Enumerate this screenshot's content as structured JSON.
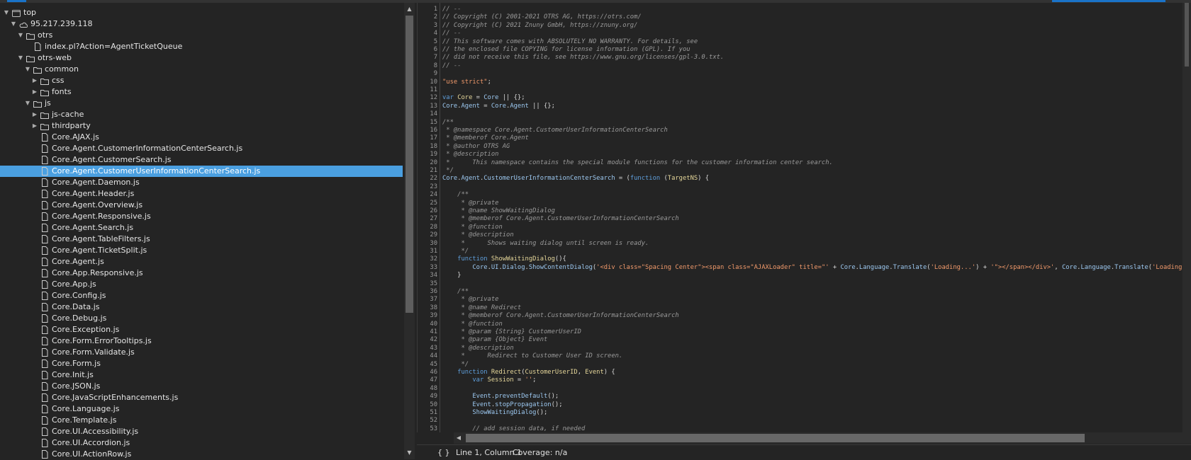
{
  "colors": {
    "accent": "#1a73c8",
    "selection": "#4a9fe0",
    "comment": "#9a9a9a",
    "string": "#f29a6b",
    "keyword": "#5f9fdc",
    "identifier": "#9cc8f0",
    "function_name": "#e6d79a"
  },
  "tree": [
    {
      "label": "top",
      "icon": "frame",
      "depth": 0,
      "expanded": true
    },
    {
      "label": "95.217.239.118",
      "icon": "cloud",
      "depth": 1,
      "expanded": true
    },
    {
      "label": "otrs",
      "icon": "folder",
      "depth": 2,
      "expanded": true
    },
    {
      "label": "index.pl?Action=AgentTicketQueue",
      "icon": "file",
      "depth": 3,
      "expanded": null
    },
    {
      "label": "otrs-web",
      "icon": "folder",
      "depth": 2,
      "expanded": true
    },
    {
      "label": "common",
      "icon": "folder",
      "depth": 3,
      "expanded": true
    },
    {
      "label": "css",
      "icon": "folder",
      "depth": 4,
      "expanded": false
    },
    {
      "label": "fonts",
      "icon": "folder",
      "depth": 4,
      "expanded": false
    },
    {
      "label": "js",
      "icon": "folder",
      "depth": 3,
      "expanded": true
    },
    {
      "label": "js-cache",
      "icon": "folder",
      "depth": 4,
      "expanded": false
    },
    {
      "label": "thirdparty",
      "icon": "folder",
      "depth": 4,
      "expanded": false
    },
    {
      "label": "Core.AJAX.js",
      "icon": "file",
      "depth": 4
    },
    {
      "label": "Core.Agent.CustomerInformationCenterSearch.js",
      "icon": "file",
      "depth": 4
    },
    {
      "label": "Core.Agent.CustomerSearch.js",
      "icon": "file",
      "depth": 4
    },
    {
      "label": "Core.Agent.CustomerUserInformationCenterSearch.js",
      "icon": "file",
      "depth": 4,
      "selected": true
    },
    {
      "label": "Core.Agent.Daemon.js",
      "icon": "file",
      "depth": 4
    },
    {
      "label": "Core.Agent.Header.js",
      "icon": "file",
      "depth": 4
    },
    {
      "label": "Core.Agent.Overview.js",
      "icon": "file",
      "depth": 4
    },
    {
      "label": "Core.Agent.Responsive.js",
      "icon": "file",
      "depth": 4
    },
    {
      "label": "Core.Agent.Search.js",
      "icon": "file",
      "depth": 4
    },
    {
      "label": "Core.Agent.TableFilters.js",
      "icon": "file",
      "depth": 4
    },
    {
      "label": "Core.Agent.TicketSplit.js",
      "icon": "file",
      "depth": 4
    },
    {
      "label": "Core.Agent.js",
      "icon": "file",
      "depth": 4
    },
    {
      "label": "Core.App.Responsive.js",
      "icon": "file",
      "depth": 4
    },
    {
      "label": "Core.App.js",
      "icon": "file",
      "depth": 4
    },
    {
      "label": "Core.Config.js",
      "icon": "file",
      "depth": 4
    },
    {
      "label": "Core.Data.js",
      "icon": "file",
      "depth": 4
    },
    {
      "label": "Core.Debug.js",
      "icon": "file",
      "depth": 4
    },
    {
      "label": "Core.Exception.js",
      "icon": "file",
      "depth": 4
    },
    {
      "label": "Core.Form.ErrorTooltips.js",
      "icon": "file",
      "depth": 4
    },
    {
      "label": "Core.Form.Validate.js",
      "icon": "file",
      "depth": 4
    },
    {
      "label": "Core.Form.js",
      "icon": "file",
      "depth": 4
    },
    {
      "label": "Core.Init.js",
      "icon": "file",
      "depth": 4
    },
    {
      "label": "Core.JSON.js",
      "icon": "file",
      "depth": 4
    },
    {
      "label": "Core.JavaScriptEnhancements.js",
      "icon": "file",
      "depth": 4
    },
    {
      "label": "Core.Language.js",
      "icon": "file",
      "depth": 4
    },
    {
      "label": "Core.Template.js",
      "icon": "file",
      "depth": 4
    },
    {
      "label": "Core.UI.Accessibility.js",
      "icon": "file",
      "depth": 4
    },
    {
      "label": "Core.UI.Accordion.js",
      "icon": "file",
      "depth": 4
    },
    {
      "label": "Core.UI.ActionRow.js",
      "icon": "file",
      "depth": 4
    }
  ],
  "code": [
    [
      [
        "c",
        "// --"
      ]
    ],
    [
      [
        "c",
        "// Copyright (C) 2001-2021 OTRS AG, https://otrs.com/"
      ]
    ],
    [
      [
        "c",
        "// Copyright (C) 2021 Znuny GmbH, https://znuny.org/"
      ]
    ],
    [
      [
        "c",
        "// --"
      ]
    ],
    [
      [
        "c",
        "// This software comes with ABSOLUTELY NO WARRANTY. For details, see"
      ]
    ],
    [
      [
        "c",
        "// the enclosed file COPYING for license information (GPL). If you"
      ]
    ],
    [
      [
        "c",
        "// did not receive this file, see https://www.gnu.org/licenses/gpl-3.0.txt."
      ]
    ],
    [
      [
        "c",
        "// --"
      ]
    ],
    [],
    [
      [
        "s",
        "\"use strict\""
      ],
      [
        "p",
        ";"
      ]
    ],
    [],
    [
      [
        "k",
        "var "
      ],
      [
        "f",
        "Core"
      ],
      [
        "p",
        " = "
      ],
      [
        "i",
        "Core"
      ],
      [
        "p",
        " || {};"
      ]
    ],
    [
      [
        "i",
        "Core"
      ],
      [
        "p",
        "."
      ],
      [
        "i",
        "Agent"
      ],
      [
        "p",
        " = "
      ],
      [
        "i",
        "Core"
      ],
      [
        "p",
        "."
      ],
      [
        "i",
        "Agent"
      ],
      [
        "p",
        " || {};"
      ]
    ],
    [],
    [
      [
        "c",
        "/**"
      ]
    ],
    [
      [
        "c",
        " * @namespace Core.Agent.CustomerUserInformationCenterSearch"
      ]
    ],
    [
      [
        "c",
        " * @memberof Core.Agent"
      ]
    ],
    [
      [
        "c",
        " * @author OTRS AG"
      ]
    ],
    [
      [
        "c",
        " * @description"
      ]
    ],
    [
      [
        "c",
        " *      This namespace contains the special module functions for the customer information center search."
      ]
    ],
    [
      [
        "c",
        " */"
      ]
    ],
    [
      [
        "i",
        "Core"
      ],
      [
        "p",
        "."
      ],
      [
        "i",
        "Agent"
      ],
      [
        "p",
        "."
      ],
      [
        "i",
        "CustomerUserInformationCenterSearch"
      ],
      [
        "p",
        " = ("
      ],
      [
        "k",
        "function"
      ],
      [
        "p",
        " ("
      ],
      [
        "f",
        "TargetNS"
      ],
      [
        "p",
        ") {"
      ]
    ],
    [],
    [
      [
        "c",
        "    /**"
      ]
    ],
    [
      [
        "c",
        "     * @private"
      ]
    ],
    [
      [
        "c",
        "     * @name ShowWaitingDialog"
      ]
    ],
    [
      [
        "c",
        "     * @memberof Core.Agent.CustomerUserInformationCenterSearch"
      ]
    ],
    [
      [
        "c",
        "     * @function"
      ]
    ],
    [
      [
        "c",
        "     * @description"
      ]
    ],
    [
      [
        "c",
        "     *      Shows waiting dialog until screen is ready."
      ]
    ],
    [
      [
        "c",
        "     */"
      ]
    ],
    [
      [
        "p",
        "    "
      ],
      [
        "k",
        "function "
      ],
      [
        "f",
        "ShowWaitingDialog"
      ],
      [
        "p",
        "(){"
      ]
    ],
    [
      [
        "p",
        "        "
      ],
      [
        "i",
        "Core"
      ],
      [
        "p",
        "."
      ],
      [
        "i",
        "UI"
      ],
      [
        "p",
        "."
      ],
      [
        "i",
        "Dialog"
      ],
      [
        "p",
        "."
      ],
      [
        "i",
        "ShowContentDialog"
      ],
      [
        "p",
        "("
      ],
      [
        "s",
        "'<div class=\"Spacing Center\"><span class=\"AJAXLoader\" title=\"'"
      ],
      [
        "p",
        " + "
      ],
      [
        "i",
        "Core"
      ],
      [
        "p",
        "."
      ],
      [
        "i",
        "Language"
      ],
      [
        "p",
        "."
      ],
      [
        "i",
        "Translate"
      ],
      [
        "p",
        "("
      ],
      [
        "s",
        "'Loading...'"
      ],
      [
        "p",
        ") + "
      ],
      [
        "s",
        "'\"></span></div>'"
      ],
      [
        "p",
        ", "
      ],
      [
        "i",
        "Core"
      ],
      [
        "p",
        "."
      ],
      [
        "i",
        "Language"
      ],
      [
        "p",
        "."
      ],
      [
        "i",
        "Translate"
      ],
      [
        "p",
        "("
      ],
      [
        "s",
        "'Loading..."
      ]
    ],
    [
      [
        "p",
        "    }"
      ]
    ],
    [],
    [
      [
        "c",
        "    /**"
      ]
    ],
    [
      [
        "c",
        "     * @private"
      ]
    ],
    [
      [
        "c",
        "     * @name Redirect"
      ]
    ],
    [
      [
        "c",
        "     * @memberof Core.Agent.CustomerUserInformationCenterSearch"
      ]
    ],
    [
      [
        "c",
        "     * @function"
      ]
    ],
    [
      [
        "c",
        "     * @param {String} CustomerUserID"
      ]
    ],
    [
      [
        "c",
        "     * @param {Object} Event"
      ]
    ],
    [
      [
        "c",
        "     * @description"
      ]
    ],
    [
      [
        "c",
        "     *      Redirect to Customer User ID screen."
      ]
    ],
    [
      [
        "c",
        "     */"
      ]
    ],
    [
      [
        "p",
        "    "
      ],
      [
        "k",
        "function "
      ],
      [
        "f",
        "Redirect"
      ],
      [
        "p",
        "("
      ],
      [
        "f",
        "CustomerUserID"
      ],
      [
        "p",
        ", "
      ],
      [
        "f",
        "Event"
      ],
      [
        "p",
        ") {"
      ]
    ],
    [
      [
        "p",
        "        "
      ],
      [
        "k",
        "var "
      ],
      [
        "f",
        "Session"
      ],
      [
        "p",
        " = "
      ],
      [
        "s",
        "''"
      ],
      [
        "p",
        ";"
      ]
    ],
    [],
    [
      [
        "p",
        "        "
      ],
      [
        "i",
        "Event"
      ],
      [
        "p",
        "."
      ],
      [
        "i",
        "preventDefault"
      ],
      [
        "p",
        "();"
      ]
    ],
    [
      [
        "p",
        "        "
      ],
      [
        "i",
        "Event"
      ],
      [
        "p",
        "."
      ],
      [
        "i",
        "stopPropagation"
      ],
      [
        "p",
        "();"
      ]
    ],
    [
      [
        "p",
        "        "
      ],
      [
        "i",
        "ShowWaitingDialog"
      ],
      [
        "p",
        "();"
      ]
    ],
    [],
    [
      [
        "c",
        "        // add session data, if needed"
      ]
    ],
    []
  ],
  "status": {
    "format_button": "{ }",
    "position": "Line 1, Column 1",
    "coverage": "Coverage: n/a"
  }
}
